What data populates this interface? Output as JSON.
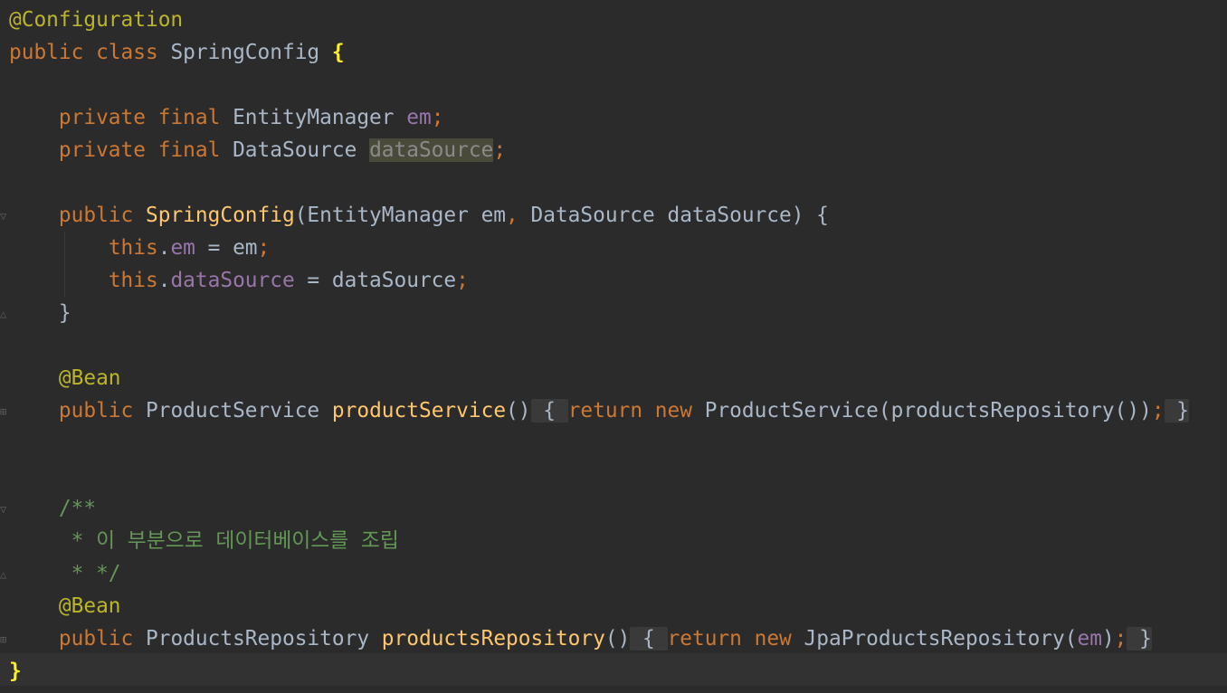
{
  "editor": {
    "lines": {
      "l1": {
        "annotation": "@Configuration"
      },
      "l2": {
        "kw_public": "public",
        "kw_class": "class",
        "class_name": "SpringConfig",
        "brace": "{"
      },
      "l4": {
        "kw_private": "private",
        "kw_final": "final",
        "type": "EntityManager",
        "field": "em",
        "semi": ";"
      },
      "l5": {
        "kw_private": "private",
        "kw_final": "final",
        "type": "DataSource",
        "field": "dataSource",
        "semi": ";"
      },
      "l7": {
        "kw_public": "public",
        "ctor": "SpringConfig",
        "params_a": "(EntityManager em",
        "comma": ",",
        "params_b": " DataSource dataSource) {"
      },
      "l8": {
        "kw_this": "this",
        "dot": ".",
        "field": "em",
        "assign": " = em",
        "semi": ";"
      },
      "l9": {
        "kw_this": "this",
        "dot": ".",
        "field": "dataSource",
        "assign": " = dataSource",
        "semi": ";"
      },
      "l10": {
        "close": "}"
      },
      "l12": {
        "annotation": "@Bean"
      },
      "l13": {
        "kw_public": "public",
        "type": "ProductService",
        "method": "productService",
        "parens": "()",
        "fold_open": "{",
        "kw_return": "return",
        "kw_new": "new",
        "expr": "ProductService(productsRepository())",
        "semi": ";",
        "fold_close": "}"
      },
      "l16": {
        "comment": "/**"
      },
      "l17": {
        "comment": " * 이 부분으로 데이터베이스를 조립"
      },
      "l18": {
        "comment": " * */"
      },
      "l19": {
        "annotation": "@Bean"
      },
      "l20": {
        "kw_public": "public",
        "type": "ProductsRepository",
        "method": "productsRepository",
        "parens": "()",
        "fold_open": "{",
        "kw_return": "return",
        "kw_new": "new",
        "expr_a": "JpaProductsRepository(",
        "field": "em",
        "expr_b": ")",
        "semi": ";",
        "fold_close": "}"
      },
      "l21": {
        "brace": "}"
      }
    },
    "colors": {
      "background": "#2b2b2b",
      "default_text": "#a9b7c6",
      "keyword": "#cc7832",
      "annotation": "#bbb529",
      "method": "#ffc66d",
      "field": "#9876aa",
      "comment": "#629755",
      "brace_match": "#ffef28"
    }
  }
}
